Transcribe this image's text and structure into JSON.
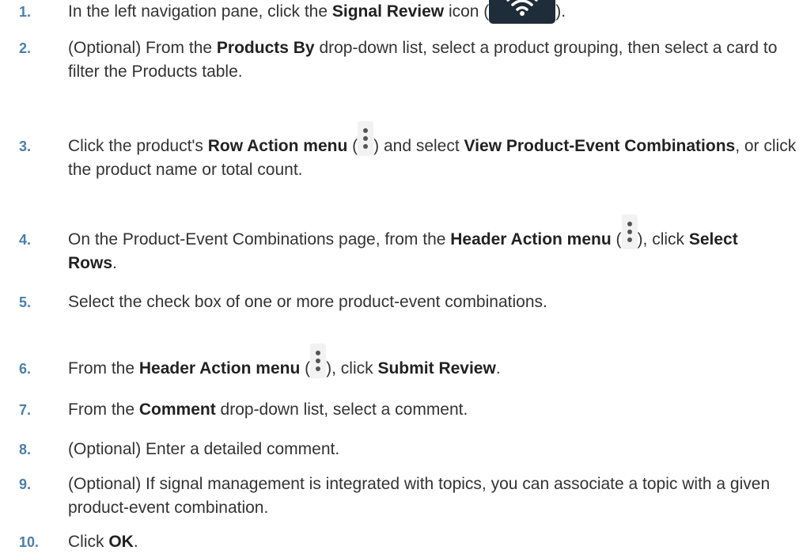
{
  "steps": [
    {
      "number": "1.",
      "text": {
        "a": "In the left navigation pane, click the ",
        "b": "Signal Review",
        "c": " icon (",
        "d": ")."
      },
      "icon": "wifi-signal-icon"
    },
    {
      "number": "2.",
      "text": {
        "a": "(Optional) From the ",
        "b": "Products By",
        "c": " drop-down list, select a product grouping, then select a card to filter the Products table."
      }
    },
    {
      "number": "3.",
      "text": {
        "a": "Click the product's ",
        "b": "Row Action menu",
        "c": " (",
        "d": ") and select ",
        "e": "View Product-Event Combinations",
        "f": ", or click the product name or total count."
      },
      "icon": "kebab-menu-icon"
    },
    {
      "number": "4.",
      "text": {
        "a": "On the Product-Event Combinations page, from the ",
        "b": "Header Action menu",
        "c": " (",
        "d": "), click ",
        "e": "Select Rows",
        "f": "."
      },
      "icon": "kebab-menu-icon"
    },
    {
      "number": "5.",
      "text": {
        "a": "Select the check box of one or more product-event combinations."
      }
    },
    {
      "number": "6.",
      "text": {
        "a": "From the ",
        "b": "Header Action menu",
        "c": " (",
        "d": "), click ",
        "e": "Submit Review",
        "f": "."
      },
      "icon": "kebab-menu-icon"
    },
    {
      "number": "7.",
      "text": {
        "a": "From the ",
        "b": "Comment",
        "c": " drop-down list, select a comment."
      }
    },
    {
      "number": "8.",
      "text": {
        "a": "(Optional) Enter a detailed comment."
      }
    },
    {
      "number": "9.",
      "text": {
        "a": "(Optional) If signal management is integrated with topics, you can associate a topic with a given product-event combination."
      }
    },
    {
      "number": "10.",
      "text": {
        "a": "Click ",
        "b": "OK",
        "c": "."
      }
    }
  ]
}
